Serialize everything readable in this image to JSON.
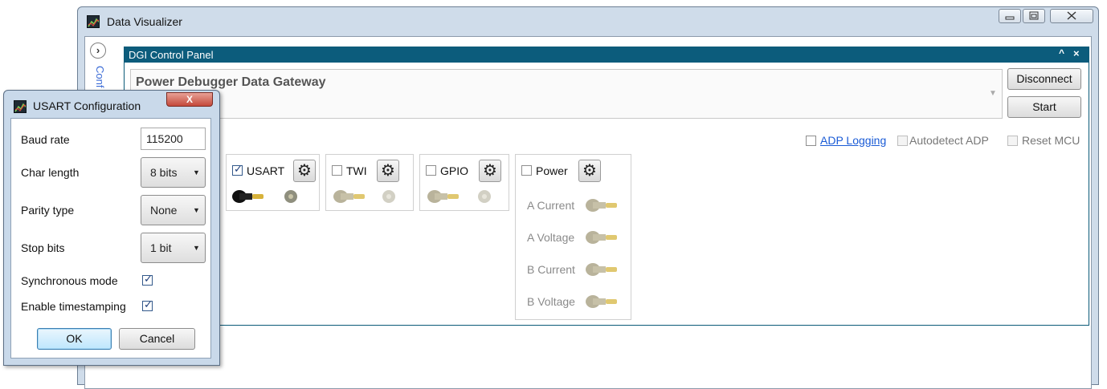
{
  "main_window": {
    "title": "Data Visualizer",
    "side_pane_label": "Conf"
  },
  "dgi_panel": {
    "title": "DGI Control Panel",
    "collapse_glyph": "^",
    "close_glyph": "×",
    "device_name": "Power Debugger Data Gateway",
    "disconnect_label": "Disconnect",
    "start_label": "Start",
    "options": {
      "adp_logging": {
        "label": "ADP Logging",
        "checked": false,
        "enabled": true
      },
      "autodetect_adp": {
        "label": "Autodetect ADP",
        "checked": false,
        "enabled": false
      },
      "reset_mcu": {
        "label": "Reset MCU",
        "checked": false,
        "enabled": false
      }
    },
    "interfaces": [
      {
        "name": "USART",
        "checked": true
      },
      {
        "name": "TWI",
        "checked": false
      },
      {
        "name": "GPIO",
        "checked": false
      },
      {
        "name": "Power",
        "checked": false
      }
    ],
    "power_channels": [
      "A Current",
      "A Voltage",
      "B Current",
      "B Voltage"
    ]
  },
  "usart_dialog": {
    "title": "USART Configuration",
    "close_glyph": "X",
    "fields": {
      "baud_rate": {
        "label": "Baud rate",
        "value": "115200"
      },
      "char_length": {
        "label": "Char length",
        "value": "8 bits"
      },
      "parity_type": {
        "label": "Parity type",
        "value": "None"
      },
      "stop_bits": {
        "label": "Stop bits",
        "value": "1 bit"
      },
      "synchronous_mode": {
        "label": "Synchronous mode",
        "checked": true
      },
      "enable_timestamping": {
        "label": "Enable timestamping",
        "checked": true
      }
    },
    "ok_label": "OK",
    "cancel_label": "Cancel"
  },
  "colors": {
    "panel_header": "#0c5c7c",
    "window_frame": "#cfdcea",
    "link": "#1a5bd6",
    "plug_active": "#111111",
    "plug_inactive": "#b9b39b",
    "plug_tip": "#d7b23a"
  }
}
